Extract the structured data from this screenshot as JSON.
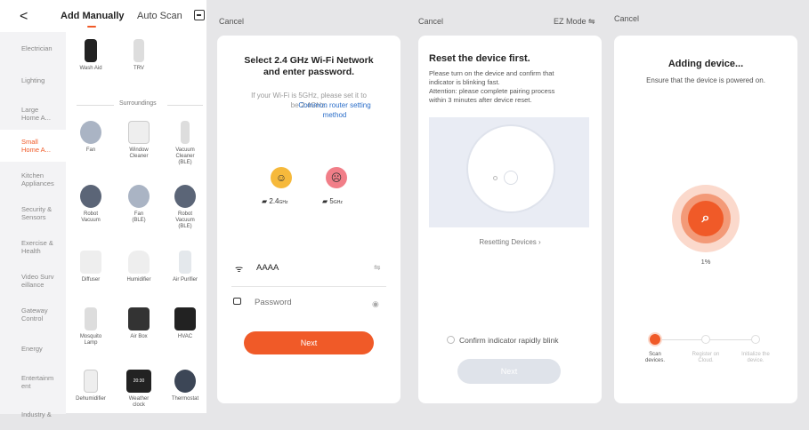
{
  "p1": {
    "back": "<",
    "tab_add": "Add Manually",
    "tab_auto": "Auto Scan",
    "categories": [
      "Electrician",
      "Lighting",
      "Large\nHome A...",
      "Small\nHome A...",
      "Kitchen\nAppliances",
      "Security &\nSensors",
      "Exercise &\nHealth",
      "Video Surv\neillance",
      "Gateway\nControl",
      "Energy",
      "Entertainm\nent",
      "Industry &"
    ],
    "section": "Surroundings",
    "devices": [
      "Wash Aid",
      "TRV",
      "Fan",
      "Window\nCleaner",
      "Vacuum\nCleaner\n(BLE)",
      "Robot\nVacuum",
      "Fan\n(BLE)",
      "Robot\nVacuum\n(BLE)",
      "Diffuser",
      "Humidifier",
      "Air Purifier",
      "Mosquito\nLamp",
      "Air Box",
      "HVAC",
      "Dehumidifier",
      "Weather\nclock",
      "Thermostat"
    ],
    "clock_text": "20:30"
  },
  "p2": {
    "cancel": "Cancel",
    "title": "Select 2.4 GHz Wi-Fi Network\nand enter password.",
    "hint": "If your Wi-Fi is 5GHz, please set it to\nbe 2.4GHz.",
    "link": "Common router setting\nmethod",
    "band_ok": "2.4",
    "band_ok_unit": "GHz",
    "band_bad": "5",
    "band_bad_unit": "GHz",
    "ssid": "AAAA",
    "password_placeholder": "Password",
    "next": "Next"
  },
  "p3": {
    "cancel": "Cancel",
    "mode": "EZ Mode ⇋",
    "title": "Reset the device first.",
    "desc": "Please turn on the device and confirm that\nindicator is blinking fast.\nAttention: please complete pairing process\nwithin 3 minutes after device reset.",
    "resetting": "Resetting Devices",
    "confirm": "Confirm indicator rapidly blink",
    "next": "Next"
  },
  "p4": {
    "cancel": "Cancel",
    "title": "Adding device...",
    "subtitle": "Ensure that the device is powered on.",
    "progress_label": "1%",
    "progress_value": 0.01,
    "steps": [
      "Scan\ndevices.",
      "Register on\nCloud.",
      "Initialize the\ndevice."
    ]
  },
  "colors": {
    "accent": "#f05a28",
    "accent_light": "#f7a07e",
    "disabled": "#dfe3ea"
  }
}
